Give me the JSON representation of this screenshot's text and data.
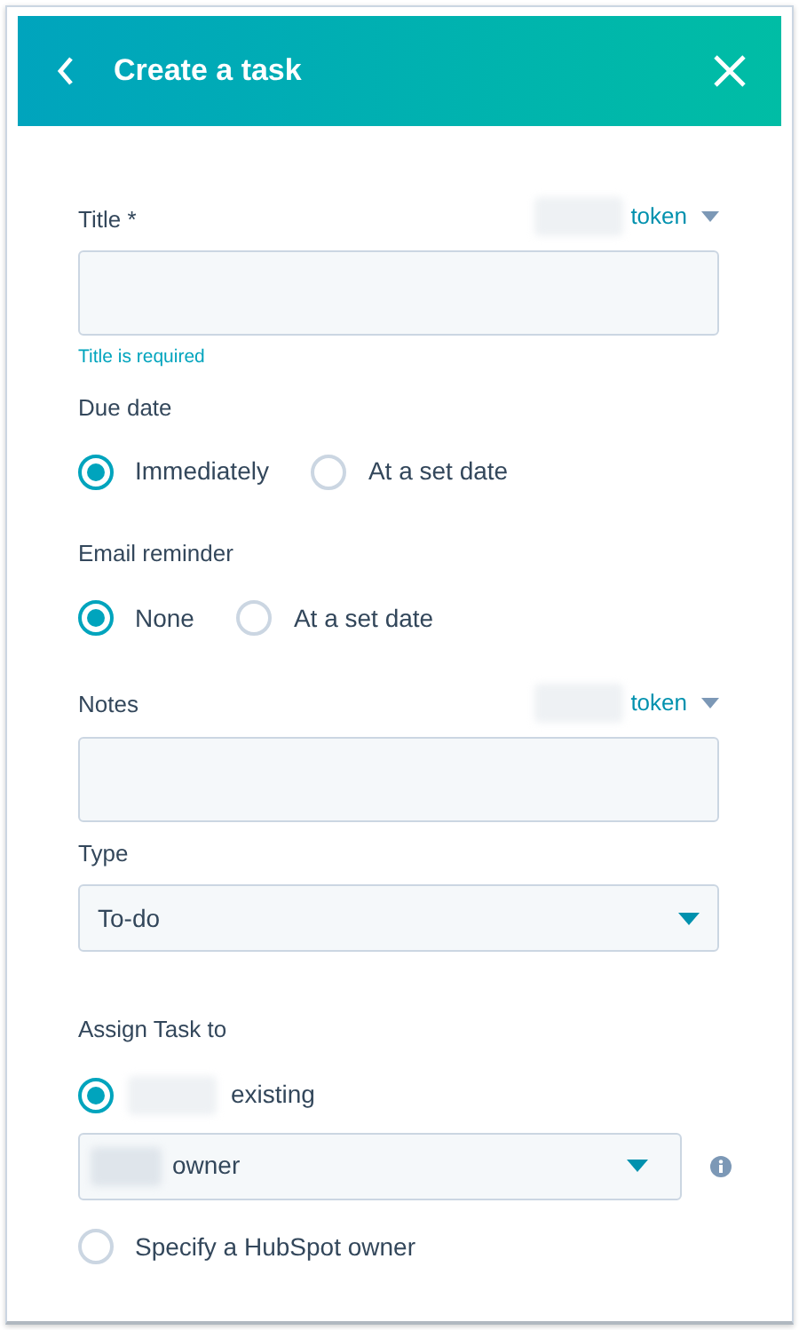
{
  "header": {
    "title": "Create a task",
    "back_icon": true,
    "close_icon": true
  },
  "fields": [
    {
      "kind": "text",
      "label": "Title *",
      "token": {
        "label": "token",
        "redacted": true
      },
      "error": "Title is required"
    },
    {
      "kind": "radios",
      "label": "Due date",
      "options": [
        {
          "label": "Immediately",
          "selected": true
        },
        {
          "label": "At a set date",
          "selected": false
        }
      ]
    },
    {
      "kind": "radios",
      "label": "Email reminder",
      "options": [
        {
          "label": "None",
          "selected": true
        },
        {
          "label": "At a set date",
          "selected": false
        }
      ]
    },
    {
      "kind": "text",
      "label": "Notes",
      "token": {
        "label": "token",
        "redacted": true
      }
    },
    {
      "kind": "select",
      "label": "Type",
      "value": "To-do"
    },
    {
      "kind": "assign",
      "label": "Assign Task to",
      "options": [
        {
          "label": "existing",
          "redacted": true,
          "selected": true,
          "select": {
            "value": "owner",
            "redacted": true
          }
        },
        {
          "label": "Specify a HubSpot owner",
          "redacted": false,
          "selected": false
        }
      ]
    }
  ]
}
